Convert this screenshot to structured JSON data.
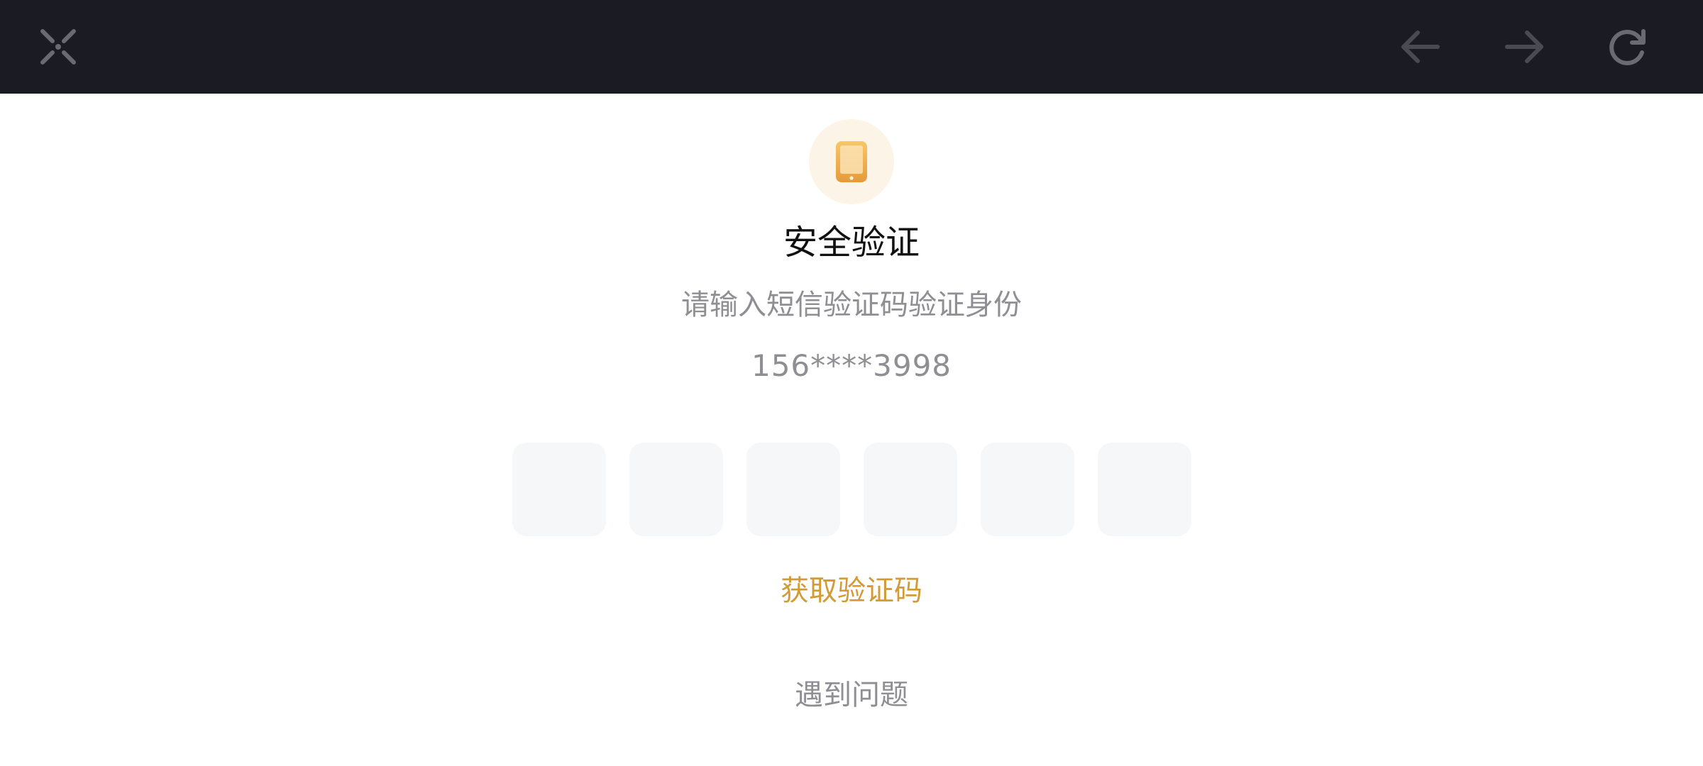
{
  "toolbar": {
    "close_icon": "close-x-icon",
    "back_icon": "arrow-left-icon",
    "forward_icon": "arrow-right-icon",
    "refresh_icon": "refresh-icon",
    "background": "#1b1b23",
    "icon_color": "#5a5a62"
  },
  "main": {
    "badge_icon": "phone-icon",
    "title": "安全验证",
    "subtitle": "请输入短信验证码验证身份",
    "phone_number": "156****3998",
    "code_boxes": [
      "",
      "",
      "",
      "",
      "",
      ""
    ],
    "get_code_label": "获取验证码",
    "help_label": "遇到问题"
  },
  "colors": {
    "accent": "#d29b36",
    "muted_text": "#8e8e93",
    "badge_bg": "#fdf4e8",
    "box_bg": "#f6f7f9"
  }
}
